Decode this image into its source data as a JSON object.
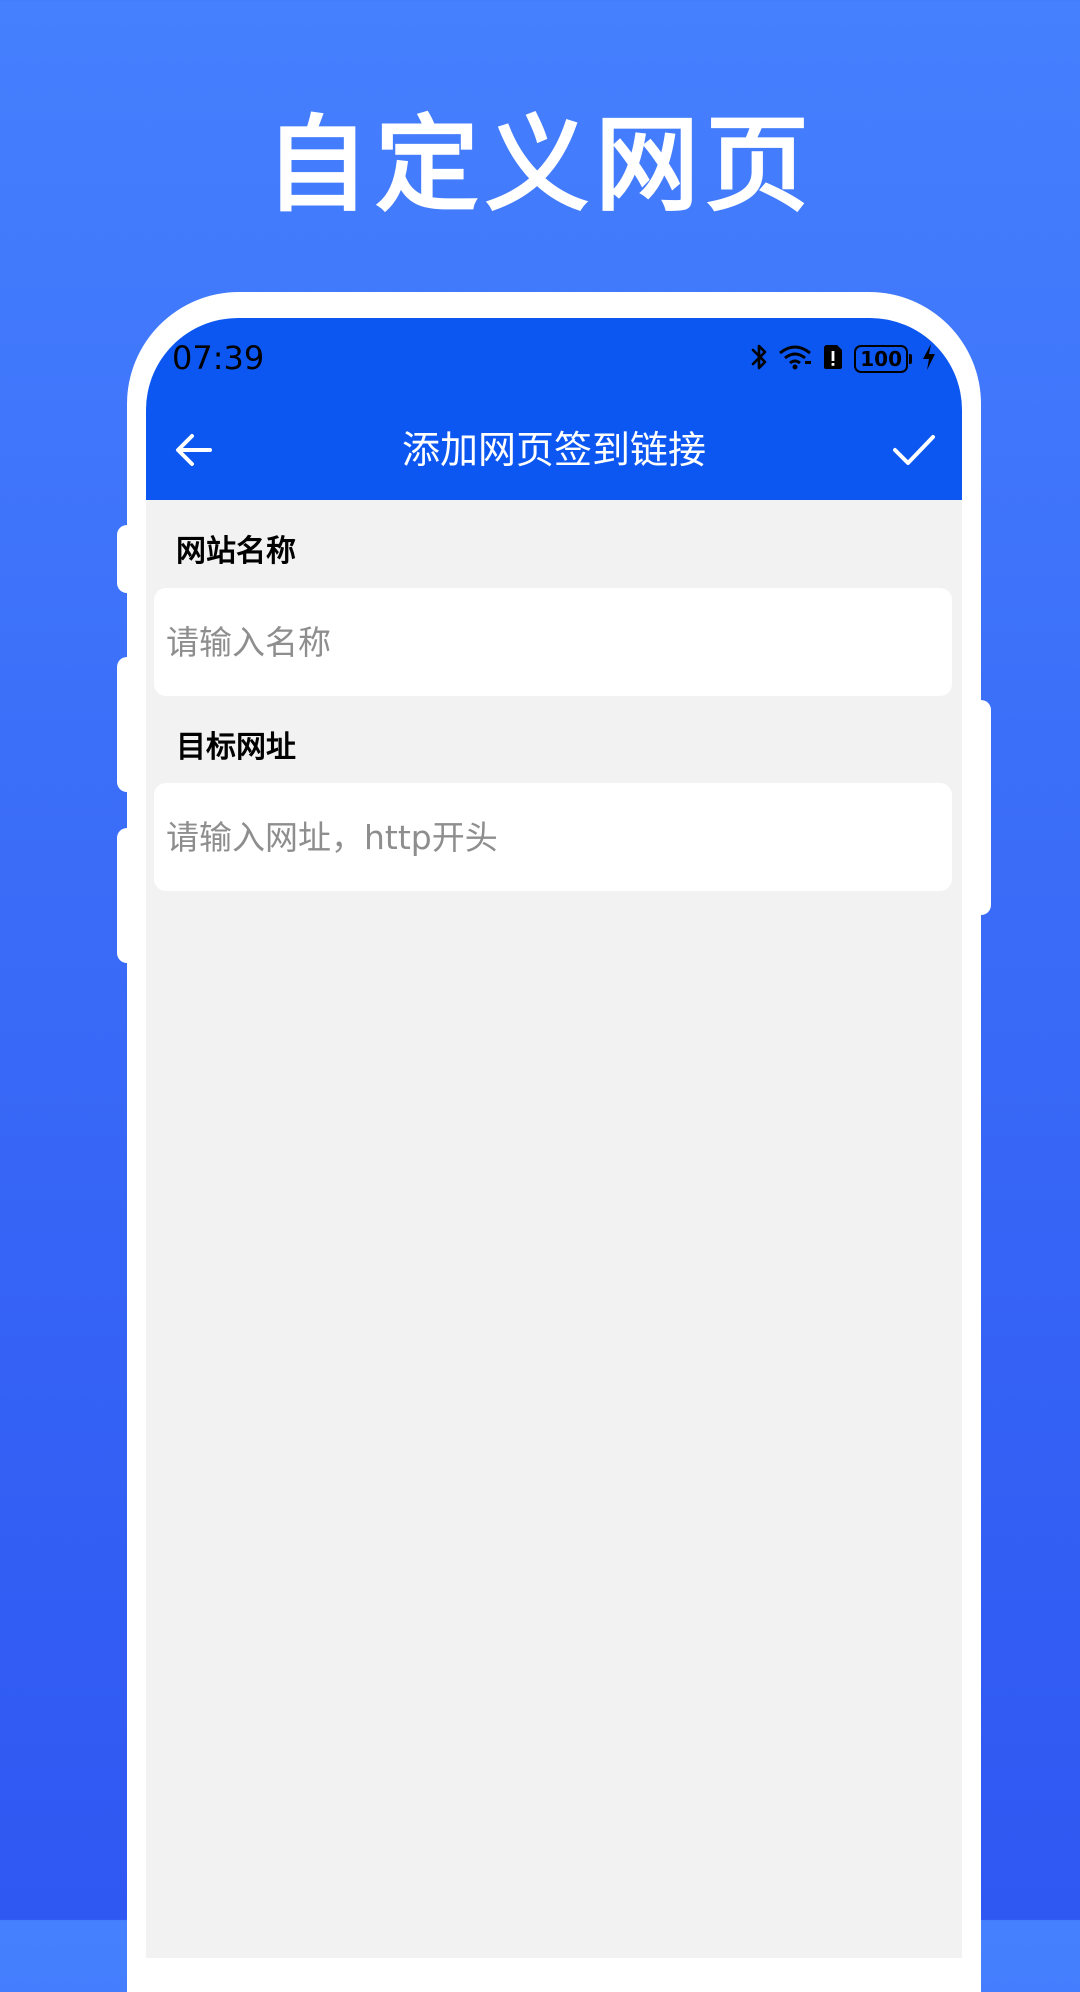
{
  "hero": {
    "title": "自定义网页"
  },
  "status_bar": {
    "time": "07:39",
    "battery": "100",
    "icons": [
      "bluetooth-icon",
      "wifi-icon",
      "sim-alert-icon",
      "battery-icon",
      "charging-bolt-icon"
    ]
  },
  "toolbar": {
    "back_icon": "arrow-left-icon",
    "title": "添加网页签到链接",
    "confirm_icon": "checkmark-icon"
  },
  "form": {
    "name_label": "网站名称",
    "name_value": "",
    "name_placeholder": "请输入名称",
    "url_label": "目标网址",
    "url_value": "",
    "url_placeholder": "请输入网址，http开头"
  },
  "colors": {
    "background_top": "#4580FE",
    "background_bottom": "#2F57F2",
    "header": "#0C57F1",
    "screen_bg": "#F2F2F2",
    "placeholder": "#8E8E8E"
  }
}
